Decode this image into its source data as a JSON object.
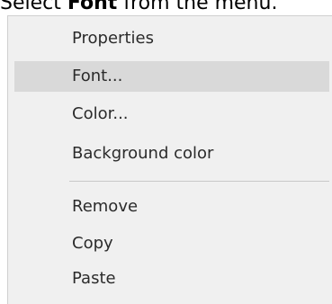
{
  "instruction": {
    "prefix": "Select ",
    "bold": "Font",
    "suffix": " from the menu."
  },
  "menu": {
    "highlighted_index": 1,
    "groups": [
      {
        "items": [
          "Properties",
          "Font...",
          "Color...",
          "Background color"
        ]
      },
      {
        "items": [
          "Remove",
          "Copy",
          "Paste"
        ]
      }
    ]
  }
}
